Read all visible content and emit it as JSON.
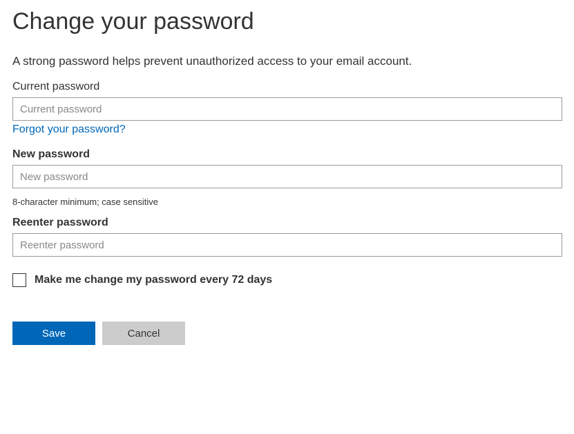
{
  "title": "Change your password",
  "description": "A strong password helps prevent unauthorized access to your email account.",
  "fields": {
    "current": {
      "label": "Current password",
      "placeholder": "Current password"
    },
    "forgot_link": "Forgot your password?",
    "new": {
      "label": "New password",
      "placeholder": "New password",
      "hint": "8-character minimum; case sensitive"
    },
    "reenter": {
      "label": "Reenter password",
      "placeholder": "Reenter password"
    }
  },
  "checkbox": {
    "label": "Make me change my password every 72 days",
    "checked": false
  },
  "buttons": {
    "save": "Save",
    "cancel": "Cancel"
  }
}
